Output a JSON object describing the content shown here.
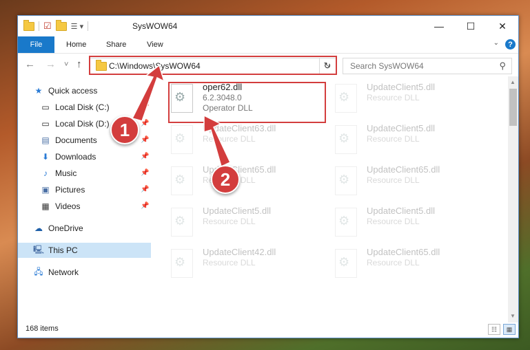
{
  "window": {
    "title": "SysWOW64",
    "minimize": "—",
    "maximize": "☐",
    "close": "✕"
  },
  "ribbon": {
    "file": "File",
    "home": "Home",
    "share": "Share",
    "view": "View",
    "help": "?"
  },
  "nav": {
    "back": "←",
    "forward": "→",
    "recent": "˅",
    "up": "↑",
    "address": "C:\\Windows\\SysWOW64",
    "refresh": "↻",
    "search_placeholder": "Search SysWOW64"
  },
  "sidebar": {
    "items": [
      {
        "label": "Quick access",
        "icon": "star-icon"
      },
      {
        "label": "Local Disk (C:)",
        "icon": "drive-icon"
      },
      {
        "label": "Local Disk (D:)",
        "icon": "drive-icon"
      },
      {
        "label": "Documents",
        "icon": "documents-icon"
      },
      {
        "label": "Downloads",
        "icon": "download-icon"
      },
      {
        "label": "Music",
        "icon": "music-icon"
      },
      {
        "label": "Pictures",
        "icon": "pictures-icon"
      },
      {
        "label": "Videos",
        "icon": "videos-icon"
      },
      {
        "label": "OneDrive",
        "icon": "cloud-icon"
      },
      {
        "label": "This PC",
        "icon": "computer-icon"
      },
      {
        "label": "Network",
        "icon": "network-icon"
      }
    ]
  },
  "files": [
    {
      "name": "oper62.dll",
      "version": "6.2.3048.0",
      "desc": "Operator DLL"
    },
    {
      "name": "UpdateClient5.dll",
      "desc": "Resource DLL"
    },
    {
      "name": "",
      "desc": ""
    },
    {
      "name": "UpdateClient63.dll",
      "desc": "Resource DLL"
    },
    {
      "name": "UpdateClient5.dll",
      "desc": "Resource DLL"
    },
    {
      "name": "UpdateClient65.dll",
      "desc": "Resource DLL"
    },
    {
      "name": "UpdateClient65.dll",
      "desc": "Resource DLL"
    },
    {
      "name": "UpdateClient5.dll",
      "desc": "Resource DLL"
    },
    {
      "name": "UpdateClient5.dll",
      "desc": "Resource DLL"
    },
    {
      "name": "UpdateClient42.dll",
      "desc": "Resource DLL"
    },
    {
      "name": "UpdateClient65.dll",
      "desc": "Resource DLL"
    }
  ],
  "status": {
    "items": "168 items"
  },
  "callouts": {
    "one": "1",
    "two": "2"
  },
  "colors": {
    "accent": "#1979ca",
    "highlight": "#d33d3d"
  }
}
